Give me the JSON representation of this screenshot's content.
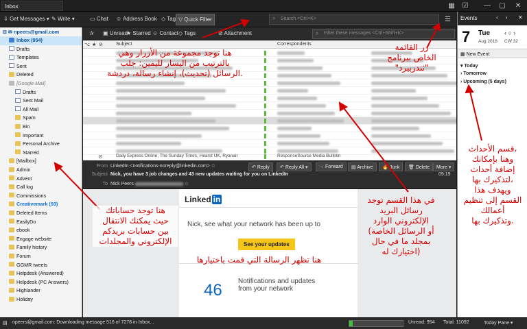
{
  "window": {
    "title": "Inbox"
  },
  "toolbar": {
    "get_messages": "Get Messages",
    "write": "Write",
    "chat": "Chat",
    "address_book": "Address Book",
    "tag": "Tag",
    "quick_filter": "Quick Filter",
    "search_placeholder": "Search <Ctrl+K>"
  },
  "filterbar": {
    "unread": "Unread",
    "starred": "Starred",
    "contact": "Contact",
    "tags": "Tags",
    "attachment": "Attachment",
    "filter_placeholder": "Filter these messages <Ctrl+Shift+K>"
  },
  "folders": {
    "account": "npeers@gmail.com",
    "items": [
      {
        "label": "Inbox (954)",
        "type": "inbox",
        "indent": 1,
        "selected": true
      },
      {
        "label": "Drafts",
        "type": "doc",
        "indent": 1
      },
      {
        "label": "Templates",
        "type": "doc",
        "indent": 1
      },
      {
        "label": "Sent",
        "type": "doc",
        "indent": 1
      },
      {
        "label": "Deleted",
        "type": "folder",
        "indent": 1
      },
      {
        "label": "[Google Mail]",
        "type": "gm",
        "indent": 1
      },
      {
        "label": "Drafts",
        "type": "doc",
        "indent": 2
      },
      {
        "label": "Sent Mail",
        "type": "doc",
        "indent": 2
      },
      {
        "label": "All Mail",
        "type": "doc",
        "indent": 2
      },
      {
        "label": "Spam",
        "type": "folder",
        "indent": 2
      },
      {
        "label": "Bin",
        "type": "folder",
        "indent": 2
      },
      {
        "label": "Important",
        "type": "folder",
        "indent": 2
      },
      {
        "label": "Personal Archive",
        "type": "folder",
        "indent": 2
      },
      {
        "label": "Starred",
        "type": "folder",
        "indent": 2
      },
      {
        "label": "[Mailbox]",
        "type": "folder",
        "indent": 1
      },
      {
        "label": "Admin",
        "type": "folder",
        "indent": 1
      },
      {
        "label": "Advent",
        "type": "folder",
        "indent": 1
      },
      {
        "label": "Call log",
        "type": "folder",
        "indent": 1
      },
      {
        "label": "Commissions",
        "type": "folder",
        "indent": 1
      },
      {
        "label": "Creativemark (93)",
        "type": "folder",
        "indent": 1,
        "highlight": true
      },
      {
        "label": "Deleted Items",
        "type": "folder",
        "indent": 1
      },
      {
        "label": "EasilyDo",
        "type": "folder",
        "indent": 1
      },
      {
        "label": "ebook",
        "type": "folder",
        "indent": 1
      },
      {
        "label": "Engage website",
        "type": "folder",
        "indent": 1
      },
      {
        "label": "Family history",
        "type": "folder",
        "indent": 1
      },
      {
        "label": "Forum",
        "type": "folder",
        "indent": 1
      },
      {
        "label": "GGMR tweets",
        "type": "folder",
        "indent": 1
      },
      {
        "label": "Helpdesk (Answered)",
        "type": "folder",
        "indent": 1
      },
      {
        "label": "Helpdesk (PC Answers)",
        "type": "folder",
        "indent": 1
      },
      {
        "label": "Highlander",
        "type": "folder",
        "indent": 1
      },
      {
        "label": "Holiday",
        "type": "folder",
        "indent": 1
      }
    ]
  },
  "list": {
    "col_subject": "Subject",
    "col_correspondents": "Correspondents",
    "last_subject": "Daily Express Online, The Sunday Times, Hearst UK, Ryanair",
    "last_correspondent": "ResponseSource Media Bulletin"
  },
  "header": {
    "from_label": "From",
    "from_value": "LinkedIn <notifications-noreply@linkedin.com>",
    "subject_label": "Subject",
    "subject_value": "Nick, you have 3 job changes and 43 new updates waiting for you on LinkedIn",
    "time": "09:19",
    "to_label": "To",
    "to_value": "Nick Peers",
    "reply": "Reply",
    "reply_all": "Reply All",
    "forward": "Forward",
    "archive": "Archive",
    "junk": "Junk",
    "delete": "Delete",
    "more": "More"
  },
  "body": {
    "brand": "Linked",
    "brand_in": "in",
    "greeting": "Nick, see what your network has been up to",
    "cta": "See your updates",
    "count": "46",
    "count_text": "Notifications and updates from your network"
  },
  "events": {
    "title": "Events",
    "day": "7",
    "weekday": "Tue",
    "month_year": "Aug 2018",
    "week": "CW 32",
    "new_event": "New Event",
    "today": "Today",
    "tomorrow": "Tomorrow",
    "upcoming": "Upcoming (5 days)"
  },
  "status": {
    "text": "npeers@gmail.com: Downloading message 516 of 7278 in Inbox...",
    "unread": "Unread: 954",
    "total": "Total: 11092",
    "today_pane": "Today Pane"
  },
  "annotations": {
    "toolbar": "هنا توجد مجموعة من الأزرار وهي\nبالترتيب من اليسار لليمين: جلب\nالرسائل (تحديث)، إنشاء رسالة، دردشة.",
    "menu": "زر القائمة\nالخاص ببرنامج\n\"ثندربيرد\"",
    "folders": "هنا توجد حساباتك\nحيث يمكنك الانتقال\nبين حسابات بريدكم\nالإلكتروني والمجلدات",
    "message": "هنا تظهر الرسالة التي قمت باختيارها",
    "list": "في هذا القسم توجد\nرسائل البريد\nالإلكتروني الوارد\n(أو الرسائل الخاصة\nبمجلد ما في حال\nاختيارك له)",
    "events": "قسم الأحداث،\nوهنا بإمكانك\nإضافة أحداث\nلتذكيرك بها،\nويهدف هذا\nالقسم إلى تنظيم\nأعمالك\nوتذكيرك بها."
  }
}
